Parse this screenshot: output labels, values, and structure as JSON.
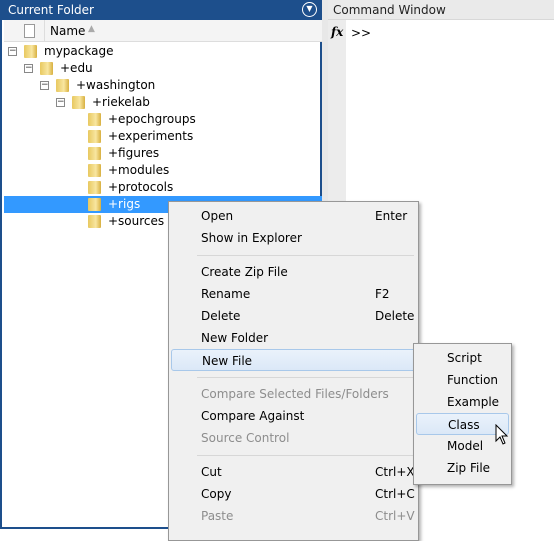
{
  "left_panel": {
    "title": "Current Folder",
    "column_name": "Name",
    "tree": [
      {
        "label": "mypackage",
        "level": 0,
        "expanded": true
      },
      {
        "label": "+edu",
        "level": 1,
        "expanded": true
      },
      {
        "label": "+washington",
        "level": 2,
        "expanded": true
      },
      {
        "label": "+riekelab",
        "level": 3,
        "expanded": true
      },
      {
        "label": "+epochgroups",
        "level": 4
      },
      {
        "label": "+experiments",
        "level": 4
      },
      {
        "label": "+figures",
        "level": 4
      },
      {
        "label": "+modules",
        "level": 4
      },
      {
        "label": "+protocols",
        "level": 4
      },
      {
        "label": "+rigs",
        "level": 4,
        "selected": true
      },
      {
        "label": "+sources",
        "level": 4
      }
    ]
  },
  "command_window": {
    "title": "Command Window",
    "fx": "fx",
    "prompt": ">>"
  },
  "context_menu": {
    "items": [
      {
        "label": "Open",
        "shortcut": "Enter"
      },
      {
        "label": "Show in Explorer",
        "shortcut": ""
      },
      {
        "sep": true
      },
      {
        "label": "Create Zip File",
        "shortcut": ""
      },
      {
        "label": "Rename",
        "shortcut": "F2"
      },
      {
        "label": "Delete",
        "shortcut": "Delete"
      },
      {
        "label": "New Folder",
        "shortcut": ""
      },
      {
        "label": "New File",
        "shortcut": "",
        "submenu": true,
        "highlighted": true
      },
      {
        "sep": true
      },
      {
        "label": "Compare Selected Files/Folders",
        "shortcut": "",
        "disabled": true
      },
      {
        "label": "Compare Against",
        "shortcut": "",
        "submenu": true
      },
      {
        "label": "Source Control",
        "shortcut": "",
        "submenu": true,
        "disabled": true
      },
      {
        "sep": true
      },
      {
        "label": "Cut",
        "shortcut": "Ctrl+X"
      },
      {
        "label": "Copy",
        "shortcut": "Ctrl+C"
      },
      {
        "label": "Paste",
        "shortcut": "Ctrl+V",
        "disabled": true
      }
    ]
  },
  "submenu": {
    "items": [
      {
        "label": "Script"
      },
      {
        "label": "Function"
      },
      {
        "label": "Example"
      },
      {
        "label": "Class",
        "highlighted": true
      },
      {
        "label": "Model"
      },
      {
        "label": "Zip File"
      }
    ]
  },
  "colors": {
    "panel_title": "#1d4f8c",
    "selection": "#3399ff"
  }
}
